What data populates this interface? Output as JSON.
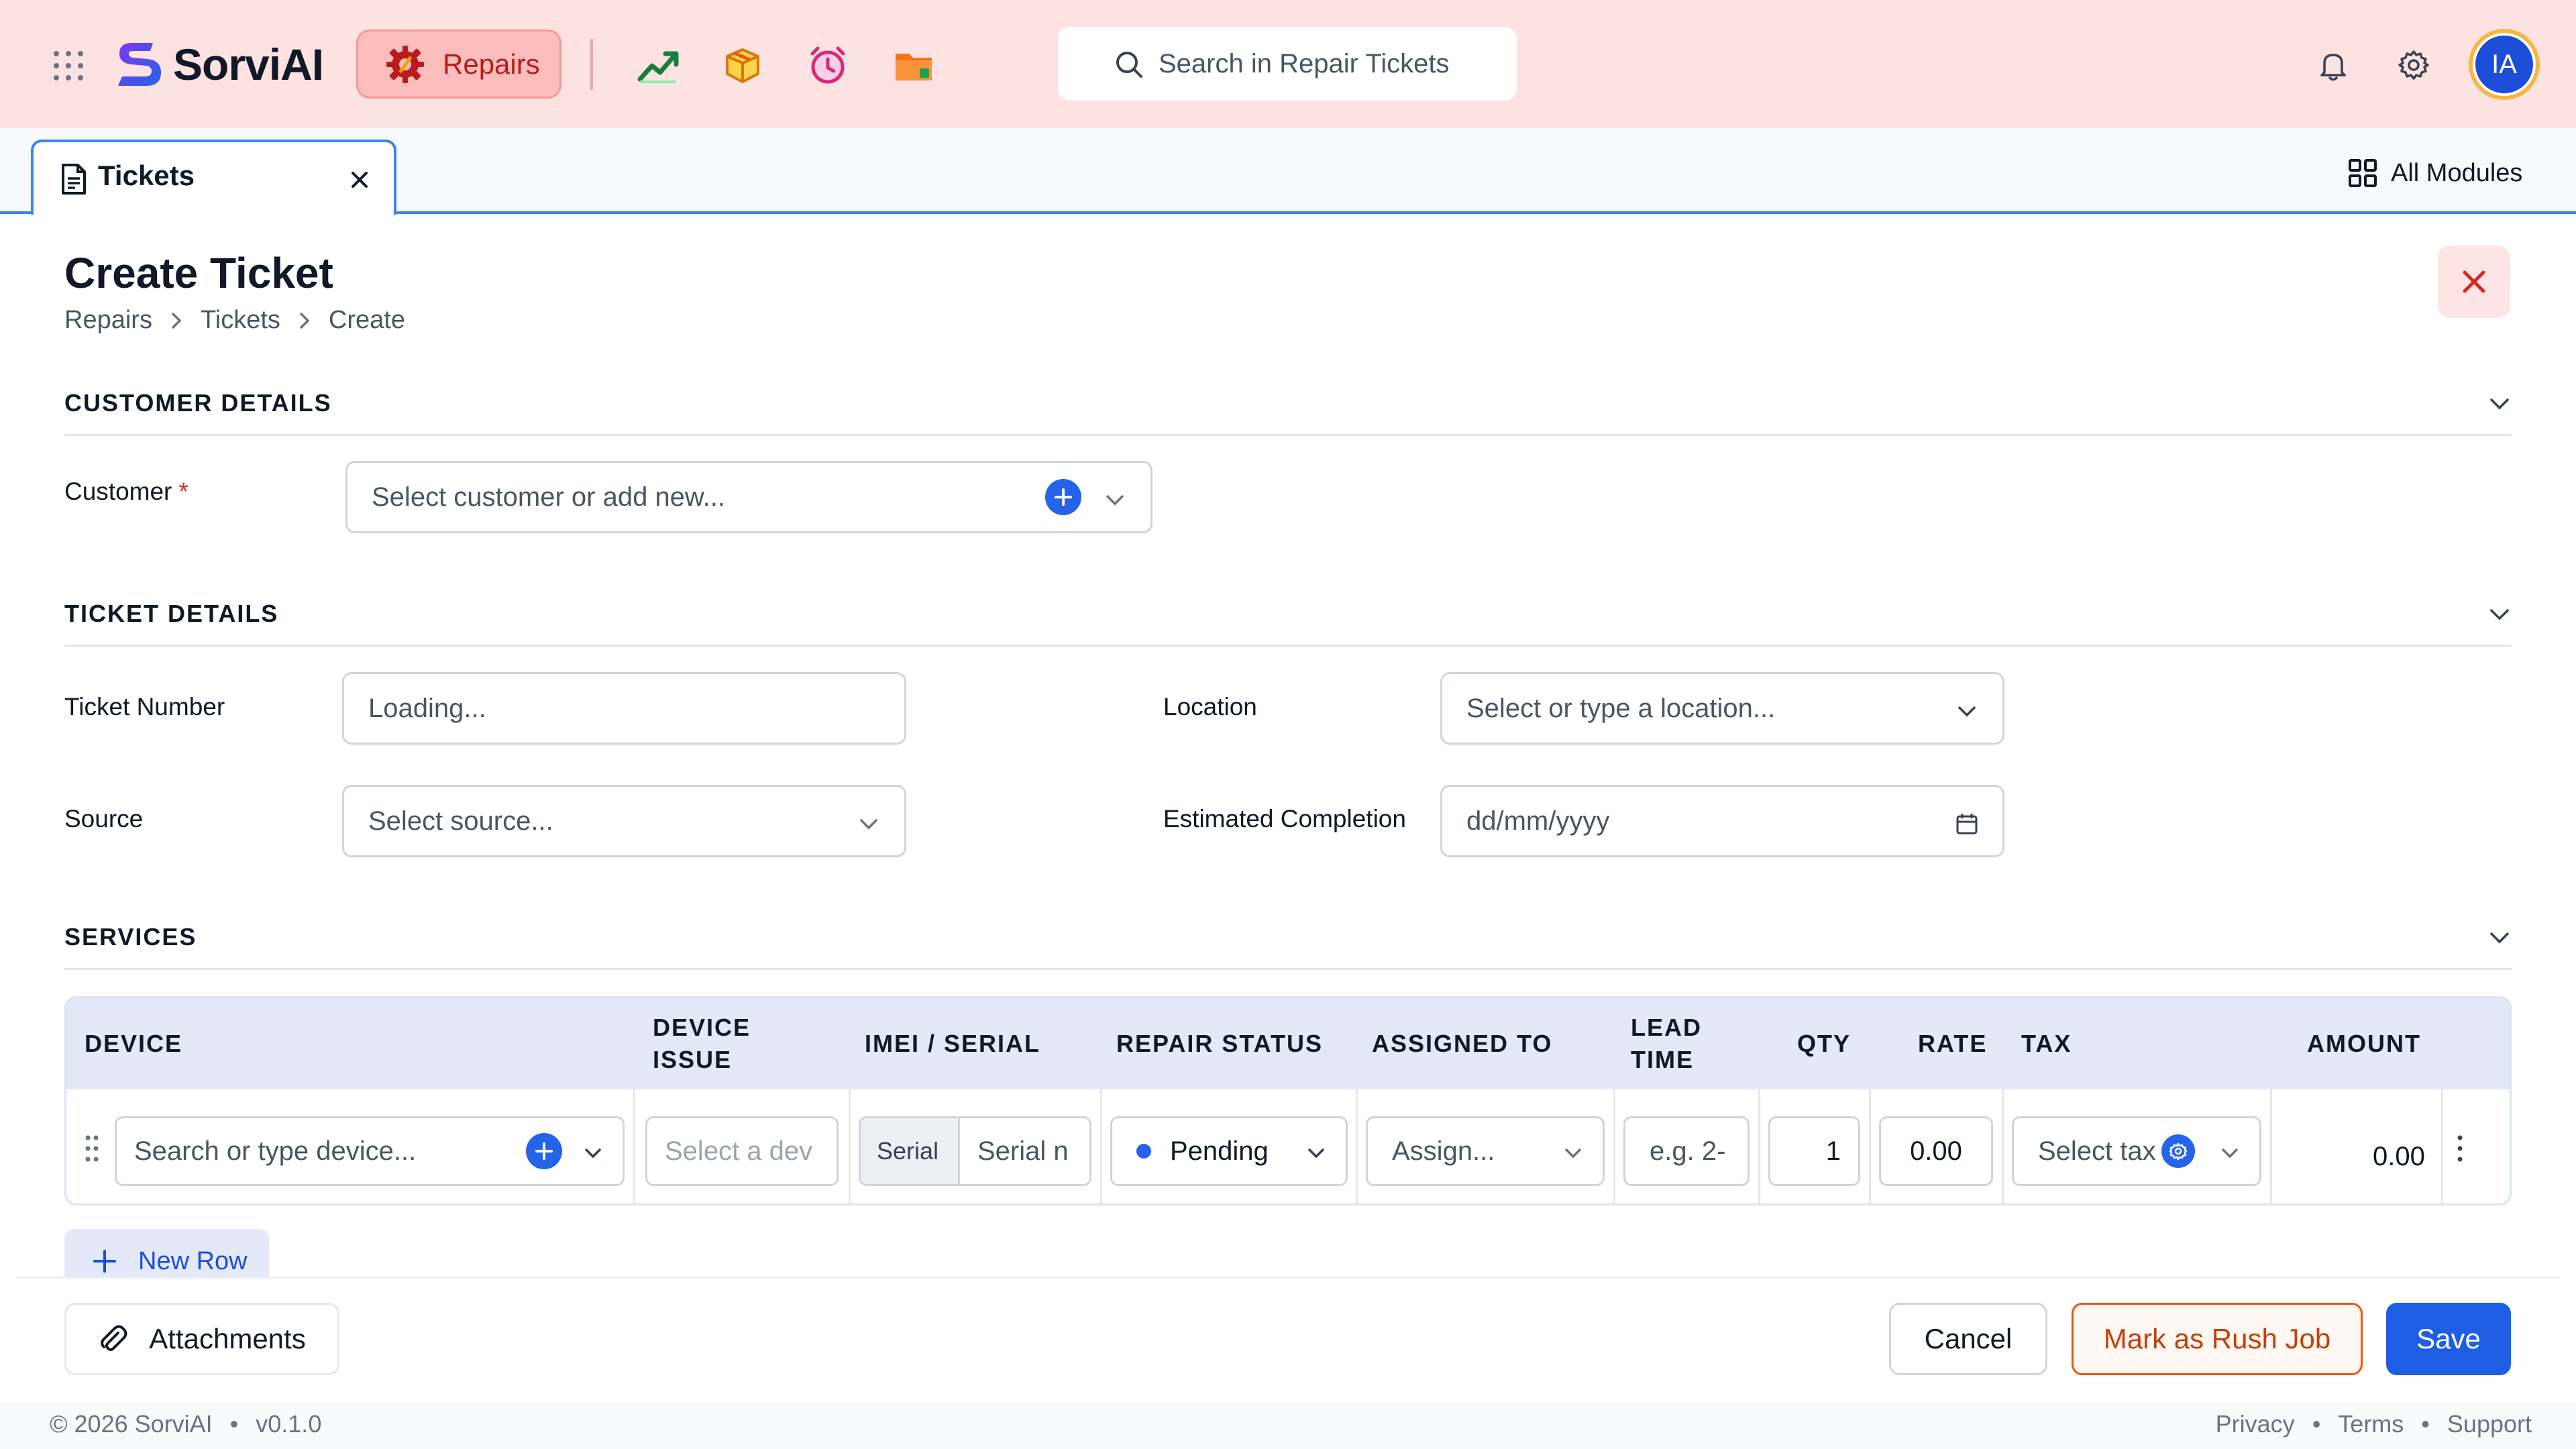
{
  "brand": {
    "name": "SorviAI",
    "active_module": "Repairs",
    "accent": "#2563eb",
    "module_color": "#b91c1c"
  },
  "header": {
    "search_placeholder": "Search in Repair Tickets",
    "user_initials": "IA",
    "apps": [
      "trending-chart-icon",
      "package-box-icon",
      "alarm-clock-icon",
      "folder-icon"
    ]
  },
  "tabs": {
    "active_label": "Tickets",
    "all_modules_label": "All Modules"
  },
  "page": {
    "title": "Create Ticket",
    "breadcrumb": [
      "Repairs",
      "Tickets",
      "Create"
    ]
  },
  "sections": {
    "customer": {
      "title": "CUSTOMER DETAILS",
      "customer_label": "Customer",
      "required_mark": "*",
      "customer_placeholder": "Select customer or add new..."
    },
    "ticket": {
      "title": "TICKET DETAILS",
      "ticket_number_label": "Ticket Number",
      "ticket_number_value": "Loading...",
      "location_label": "Location",
      "location_placeholder": "Select or type a location...",
      "source_label": "Source",
      "source_placeholder": "Select source...",
      "estimated_label": "Estimated Completion",
      "estimated_placeholder": "dd/mm/yyyy"
    },
    "services": {
      "title": "SERVICES",
      "columns": {
        "device": "DEVICE",
        "device_issue_1": "DEVICE",
        "device_issue_2": "ISSUE",
        "imei": "IMEI / SERIAL",
        "repair_status": "REPAIR STATUS",
        "assigned_to": "ASSIGNED TO",
        "lead_time_1": "LEAD",
        "lead_time_2": "TIME",
        "qty": "QTY",
        "rate": "RATE",
        "tax": "TAX",
        "amount": "AMOUNT"
      },
      "row": {
        "device_placeholder": "Search or type device...",
        "issue_placeholder": "Select a dev",
        "serial_tag": "Serial",
        "serial_placeholder": "Serial n",
        "status": "Pending",
        "assign_placeholder": "Assign...",
        "lead_placeholder": "e.g. 2-",
        "qty": "1",
        "rate": "0.00",
        "tax_placeholder": "Select tax",
        "amount": "0.00"
      },
      "new_row_label": "New Row"
    }
  },
  "actions": {
    "attachments": "Attachments",
    "cancel": "Cancel",
    "rush": "Mark as Rush Job",
    "save": "Save"
  },
  "footer": {
    "copyright": "© 2026 SorviAI",
    "version": "v0.1.0",
    "links": [
      "Privacy",
      "Terms",
      "Support"
    ],
    "separator": "•"
  }
}
